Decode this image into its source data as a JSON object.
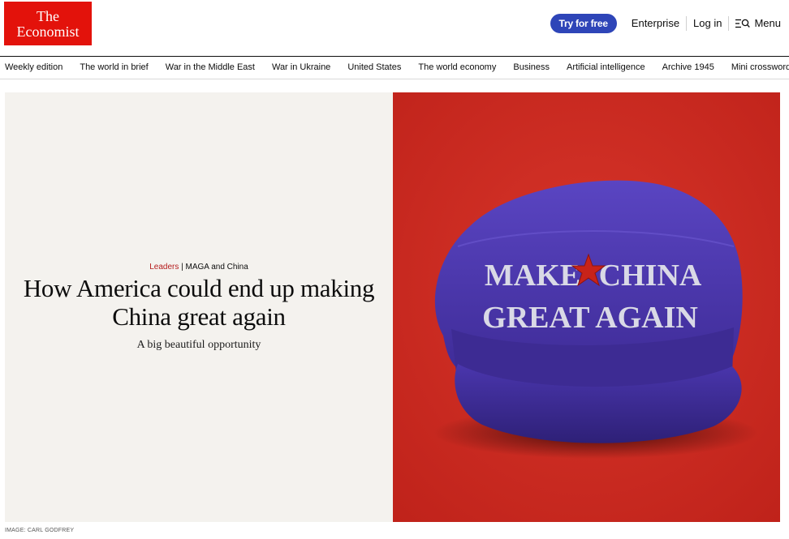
{
  "header": {
    "logo_line1": "The",
    "logo_line2": "Economist",
    "try_label": "Try for free",
    "enterprise_label": "Enterprise",
    "login_label": "Log in",
    "menu_label": "Menu"
  },
  "nav": {
    "items": [
      "Weekly edition",
      "The world in brief",
      "War in the Middle East",
      "War in Ukraine",
      "United States",
      "The world economy",
      "Business",
      "Artificial intelligence",
      "Archive 1945",
      "Mini crossword"
    ]
  },
  "article": {
    "section": "Leaders",
    "divider": "|",
    "topic": "MAGA and China",
    "headline": "How America could end up making China great again",
    "standfirst": "A big beautiful opportunity",
    "image_credit": "IMAGE: CARL GODFREY"
  },
  "hero_image": {
    "hat_line1_left": "MAKE",
    "hat_line1_right": "CHINA",
    "hat_line2": "GREAT AGAIN"
  },
  "colors": {
    "brand_red": "#e3120b",
    "button_blue": "#2e45b8",
    "hero_panel": "#f4f2ee",
    "image_red": "#cf2a20",
    "hat_purple": "#4b35a8"
  }
}
